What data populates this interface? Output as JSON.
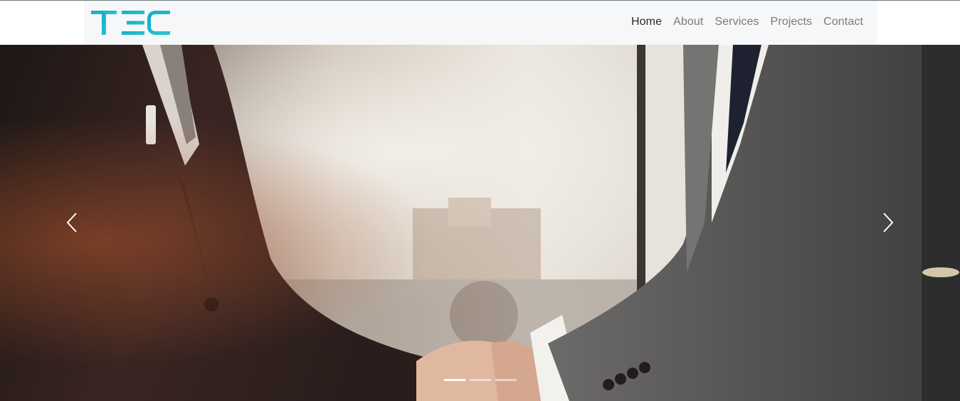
{
  "brand": {
    "logo_text": "TEC",
    "logo_colors": [
      "#1fb6c9",
      "#19a8c4"
    ]
  },
  "nav": {
    "items": [
      {
        "label": "Home",
        "active": true
      },
      {
        "label": "About",
        "active": false
      },
      {
        "label": "Services",
        "active": false
      },
      {
        "label": "Projects",
        "active": false
      },
      {
        "label": "Contact",
        "active": false
      }
    ]
  },
  "carousel": {
    "prev_icon": "chevron-left-icon",
    "next_icon": "chevron-right-icon",
    "slides_count": 3,
    "active_slide": 1,
    "slide_image": "business-handshake-photo"
  },
  "colors": {
    "accent": "#1fb6c9",
    "navbar_bg": "#f5f7f8"
  }
}
